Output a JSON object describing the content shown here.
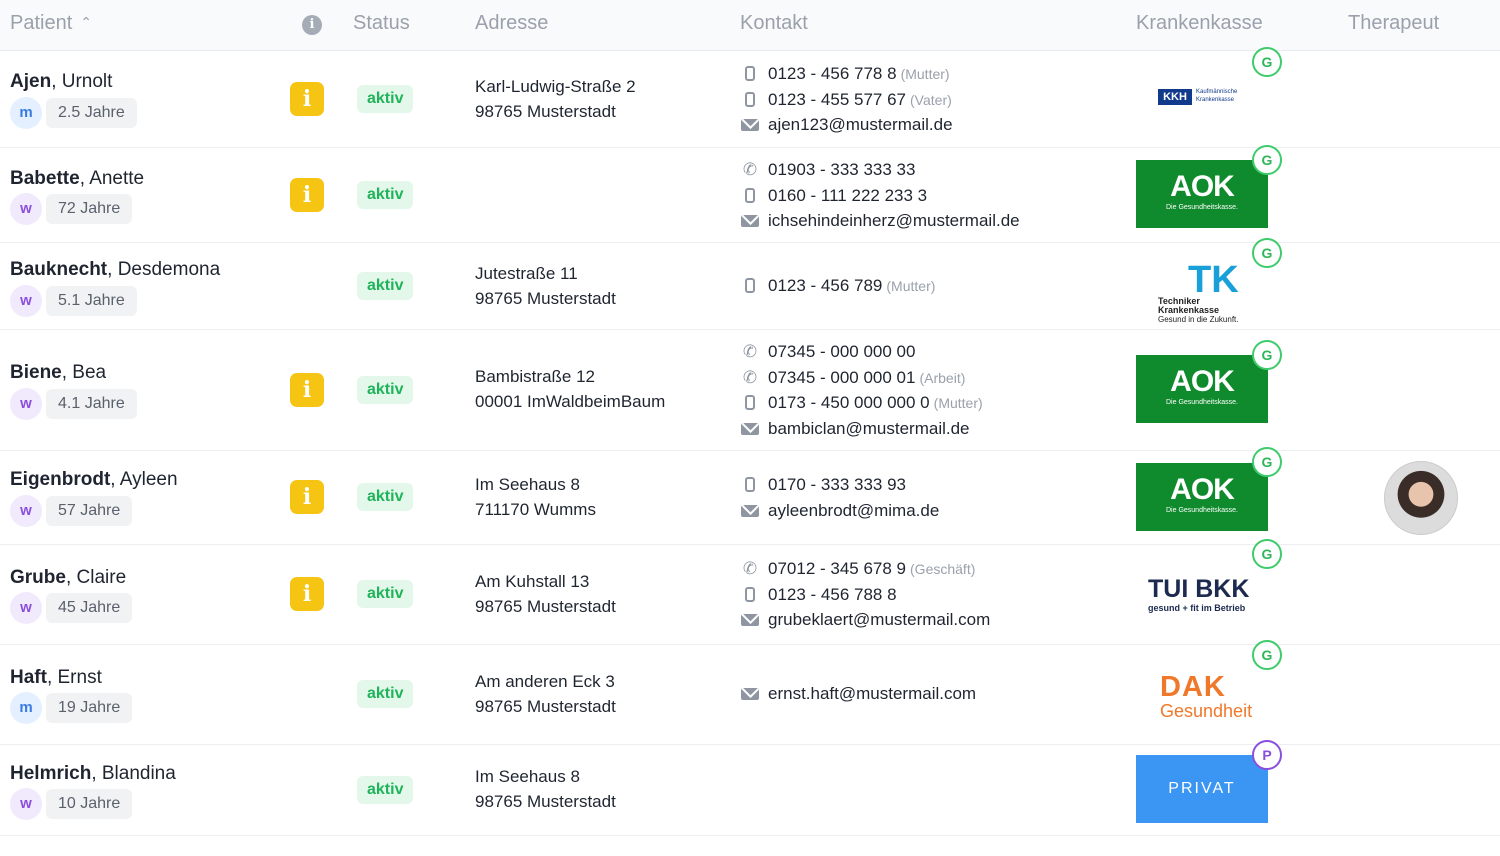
{
  "header": {
    "patient": "Patient",
    "status": "Status",
    "adresse": "Adresse",
    "kontakt": "Kontakt",
    "krankenkasse": "Krankenkasse",
    "therapeut": "Therapeut"
  },
  "patients": [
    {
      "last": "Ajen",
      "first": ", Urnolt",
      "gender": "m",
      "age": "2.5 Jahre",
      "info": "i",
      "status": "aktiv",
      "addr1": "Karl-Ludwig-Straße 2",
      "addr2": "98765 Musterstadt",
      "contacts": [
        {
          "icon": "mobile-icon",
          "value": "0123 - 456 778 8",
          "label": "(Mutter)"
        },
        {
          "icon": "mobile-icon",
          "value": "0123 - 455 577 67",
          "label": "(Vater)"
        },
        {
          "icon": "mail-icon",
          "value": "ajen123@mustermail.de",
          "label": ""
        }
      ],
      "insurance": {
        "logo": "KKH",
        "line1": "Kaufmännische",
        "line2": "Krankenkasse",
        "badge": "G"
      }
    },
    {
      "last": "Babette",
      "first": ", Anette",
      "gender": "w",
      "age": "72 Jahre",
      "info": "i",
      "status": "aktiv",
      "addr1": "",
      "addr2": "",
      "contacts": [
        {
          "icon": "phone-icon",
          "value": "01903 - 333 333 33",
          "label": ""
        },
        {
          "icon": "mobile-icon",
          "value": "0160 - 111 222 233 3",
          "label": ""
        },
        {
          "icon": "mail-icon",
          "value": "ichsehindeinherz@mustermail.de",
          "label": ""
        }
      ],
      "insurance": {
        "logo": "AOK",
        "line1": "Die Gesundheitskasse.",
        "line2": "",
        "badge": "G"
      }
    },
    {
      "last": "Bauknecht",
      "first": ", Desdemona",
      "gender": "w",
      "age": "5.1 Jahre",
      "info": "",
      "status": "aktiv",
      "addr1": "Jutestraße 11",
      "addr2": "98765 Musterstadt",
      "contacts": [
        {
          "icon": "mobile-icon",
          "value": "0123 - 456 789",
          "label": "(Mutter)"
        }
      ],
      "insurance": {
        "logo": "TK",
        "line1": "Techniker",
        "line2": "Krankenkasse",
        "line3": "Gesund in die Zukunft.",
        "badge": "G"
      }
    },
    {
      "last": "Biene",
      "first": ", Bea",
      "gender": "w",
      "age": "4.1 Jahre",
      "info": "i",
      "status": "aktiv",
      "addr1": "Bambistraße 12",
      "addr2": "00001 ImWaldbeimBaum",
      "contacts": [
        {
          "icon": "phone-icon",
          "value": "07345 - 000 000 00",
          "label": ""
        },
        {
          "icon": "phone-icon",
          "value": "07345 - 000 000 01",
          "label": "(Arbeit)"
        },
        {
          "icon": "mobile-icon",
          "value": "0173 - 450 000 000 0",
          "label": "(Mutter)"
        },
        {
          "icon": "mail-icon",
          "value": "bambiclan@mustermail.de",
          "label": ""
        }
      ],
      "insurance": {
        "logo": "AOK",
        "line1": "Die Gesundheitskasse.",
        "line2": "",
        "badge": "G"
      }
    },
    {
      "last": "Eigenbrodt",
      "first": ", Ayleen",
      "gender": "w",
      "age": "57 Jahre",
      "info": "i",
      "status": "aktiv",
      "addr1": "Im Seehaus 8",
      "addr2": "711170 Wumms",
      "contacts": [
        {
          "icon": "mobile-icon",
          "value": "0170 - 333 333 93",
          "label": ""
        },
        {
          "icon": "mail-icon",
          "value": "ayleenbrodt@mima.de",
          "label": ""
        }
      ],
      "insurance": {
        "logo": "AOK",
        "line1": "Die Gesundheitskasse.",
        "line2": "",
        "badge": "G"
      }
    },
    {
      "last": "Grube",
      "first": ", Claire",
      "gender": "w",
      "age": "45 Jahre",
      "info": "i",
      "status": "aktiv",
      "addr1": "Am Kuhstall 13",
      "addr2": "98765 Musterstadt",
      "contacts": [
        {
          "icon": "phone-icon",
          "value": "07012 - 345 678 9",
          "label": "(Geschäft)"
        },
        {
          "icon": "mobile-icon",
          "value": "0123 - 456 788 8",
          "label": ""
        },
        {
          "icon": "mail-icon",
          "value": "grubeklaert@mustermail.com",
          "label": ""
        }
      ],
      "insurance": {
        "logo": "TUI BKK",
        "line1": "gesund + fit im Betrieb",
        "line2": "",
        "badge": "G"
      }
    },
    {
      "last": "Haft",
      "first": ", Ernst",
      "gender": "m",
      "age": "19 Jahre",
      "info": "",
      "status": "aktiv",
      "addr1": "Am anderen Eck 3",
      "addr2": "98765 Musterstadt",
      "contacts": [
        {
          "icon": "mail-icon",
          "value": "ernst.haft@mustermail.com",
          "label": ""
        }
      ],
      "insurance": {
        "logo": "DAK",
        "line1": "Gesundheit",
        "line2": "",
        "badge": "G"
      }
    },
    {
      "last": "Helmrich",
      "first": ", Blandina",
      "gender": "w",
      "age": "10 Jahre",
      "info": "",
      "status": "aktiv",
      "addr1": "Im Seehaus 8",
      "addr2": "98765 Musterstadt",
      "contacts": [],
      "insurance": {
        "logo": "PRIVAT",
        "line1": "",
        "line2": "",
        "badge": "P"
      }
    }
  ]
}
